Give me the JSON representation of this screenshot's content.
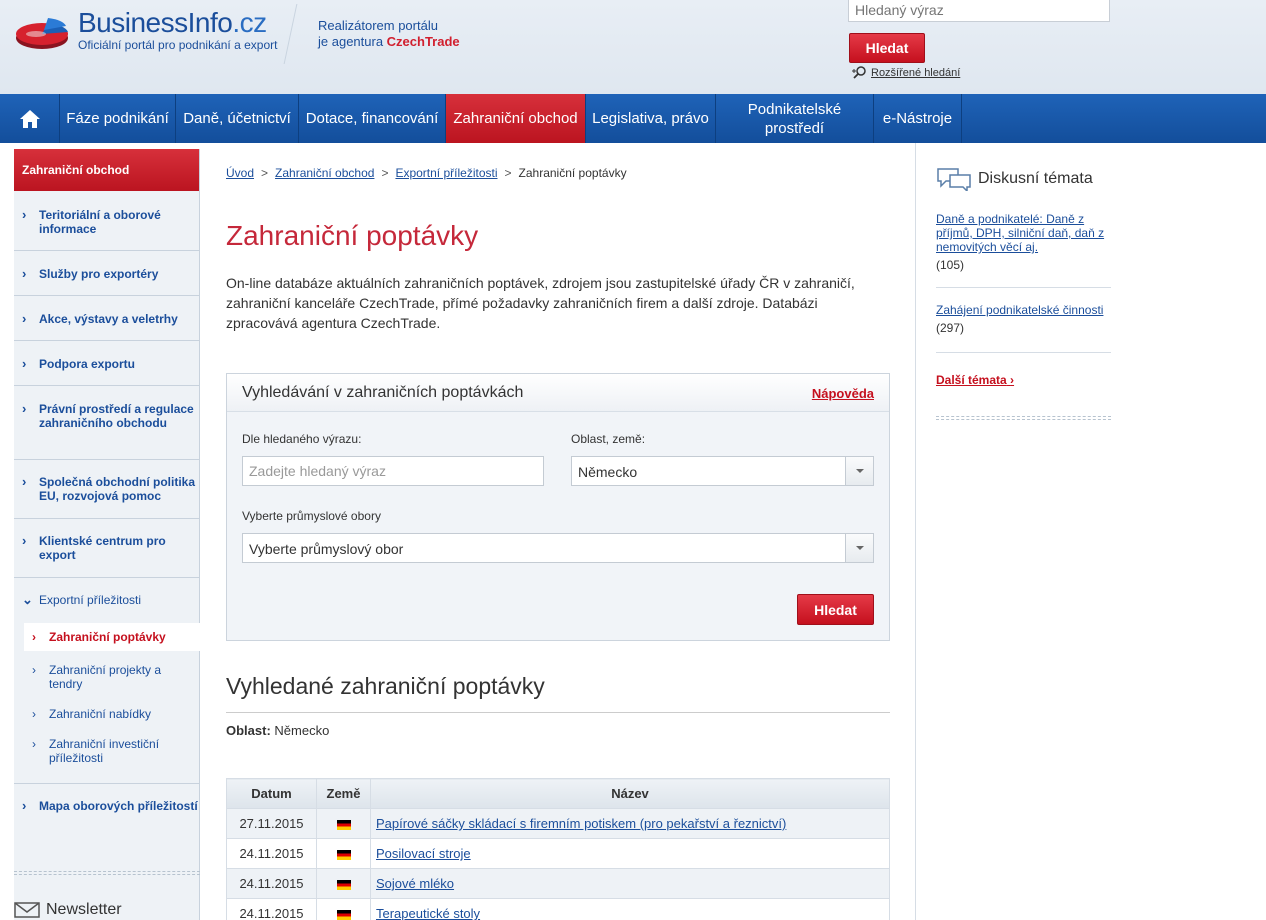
{
  "header": {
    "brand_name": "BusinessInfo",
    "brand_tld": ".cz",
    "brand_tagline": "Oficiální portál pro podnikání a export",
    "realizator_line1": "Realizátorem portálu",
    "realizator_line2_prefix": "je agentura ",
    "realizator_agency": "CzechTrade",
    "search_placeholder": "Hledaný výraz",
    "search_button": "Hledat",
    "advanced_search": "Rozšířené hledání"
  },
  "nav": {
    "items": [
      {
        "label": "Fáze podnikání"
      },
      {
        "label": "Daně, účetnictví"
      },
      {
        "label": "Dotace, financování"
      },
      {
        "label": "Zahraniční obchod"
      },
      {
        "label": "Legislativa, právo"
      },
      {
        "label": "Podnikatelské prostředí"
      },
      {
        "label": "e-Nástroje"
      }
    ]
  },
  "sidebar": {
    "heading": "Zahraniční obchod",
    "items": [
      {
        "label": "Teritoriální a oborové informace"
      },
      {
        "label": "Služby pro exportéry"
      },
      {
        "label": "Akce, výstavy a veletrhy"
      },
      {
        "label": "Podpora exportu"
      },
      {
        "label": "Právní prostředí a regulace zahraničního obchodu"
      },
      {
        "label": "Společná obchodní politika EU, rozvojová pomoc"
      },
      {
        "label": "Klientské centrum pro export"
      },
      {
        "label": "Exportní příležitosti"
      },
      {
        "label": "Mapa oborových příležitostí"
      }
    ],
    "subitems": [
      {
        "label": "Zahraniční poptávky"
      },
      {
        "label": "Zahraniční projekty a tendry"
      },
      {
        "label": "Zahraniční nabídky"
      },
      {
        "label": "Zahraniční investiční příležitosti"
      }
    ],
    "newsletter": "Newsletter"
  },
  "breadcrumb": {
    "items": [
      "Úvod",
      "Zahraniční obchod",
      "Exportní příležitosti"
    ],
    "current": "Zahraniční poptávky"
  },
  "main": {
    "title": "Zahraniční poptávky",
    "intro": "On-line databáze aktuálních zahraničních poptávek, zdrojem jsou zastupitelské úřady ČR v zahraničí, zahraniční kanceláře CzechTrade, přímé požadavky zahraničních firem a další zdroje. Databázi zpracovává agentura CzechTrade."
  },
  "search_form": {
    "title": "Vyhledávání v zahraničních poptávkách",
    "help": "Nápověda",
    "keyword_label": "Dle hledaného výrazu:",
    "keyword_placeholder": "Zadejte hledaný výraz",
    "region_label": "Oblast, země:",
    "region_value": "Německo",
    "industry_label": "Vyberte průmyslové obory",
    "industry_value": "Vyberte průmyslový obor",
    "submit": "Hledat"
  },
  "results": {
    "title": "Vyhledané zahraniční poptávky",
    "area_label": "Oblast:",
    "area_value": "Německo",
    "columns": [
      "Datum",
      "Země",
      "Název"
    ],
    "rows": [
      {
        "date": "27.11.2015",
        "country": "de-flag",
        "name": "Papírové sáčky skládací s firemním potiskem (pro pekařství a řeznictví)"
      },
      {
        "date": "24.11.2015",
        "country": "de-flag",
        "name": "Posilovací stroje"
      },
      {
        "date": "24.11.2015",
        "country": "de-flag",
        "name": "Sojové mléko"
      },
      {
        "date": "24.11.2015",
        "country": "de-flag",
        "name": "Terapeutické stoly"
      }
    ]
  },
  "discussion": {
    "heading": "Diskusní témata",
    "topics": [
      {
        "title": "Daně a podnikatelé: Daně z příjmů, DPH, silniční daň, daň z nemovitých věcí aj.",
        "count": "(105)"
      },
      {
        "title": "Zahájení podnikatelské činnosti",
        "count": "(297)"
      }
    ],
    "more": "Další témata"
  },
  "colors": {
    "brand_blue": "#1b4e9b",
    "accent_red": "#c5101e",
    "nav_blue": "#1a5aab"
  }
}
